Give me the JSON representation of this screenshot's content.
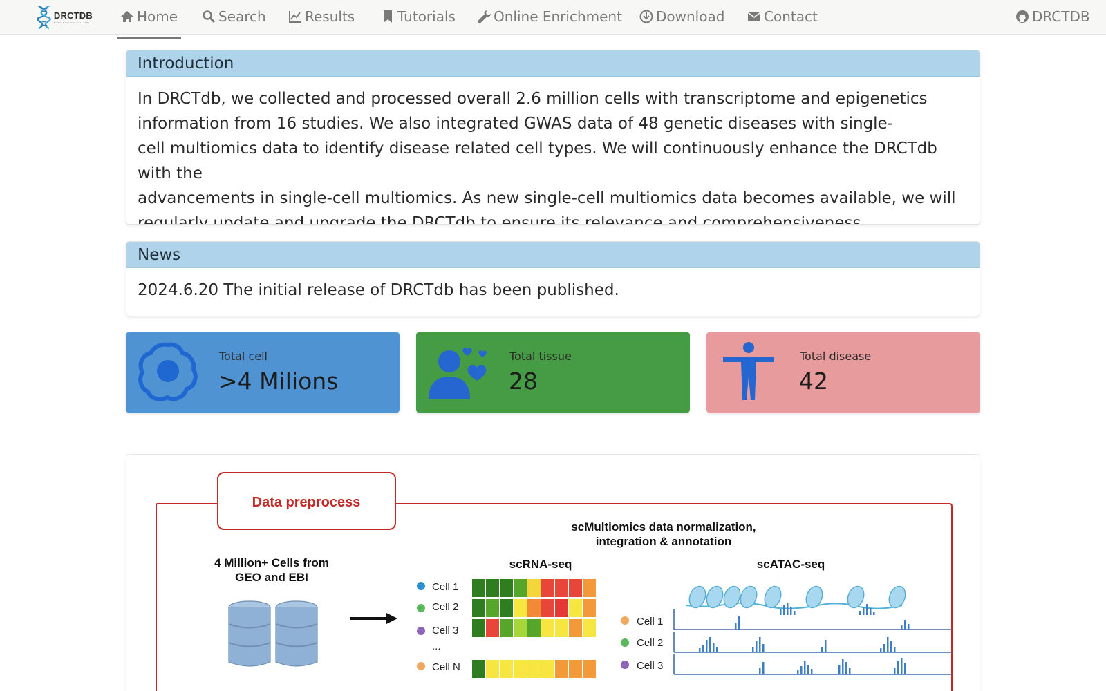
{
  "brand": {
    "name": "DRCTDB",
    "subtitle": "DISEASE RELATED CELL TYPE"
  },
  "nav": {
    "items": [
      {
        "label": "Home",
        "icon": "home-icon"
      },
      {
        "label": "Search",
        "icon": "search-icon"
      },
      {
        "label": "Results",
        "icon": "chart-line-icon"
      },
      {
        "label": "Tutorials",
        "icon": "bookmark-icon"
      },
      {
        "label": "Online Enrichment",
        "icon": "wrench-icon"
      },
      {
        "label": "Download",
        "icon": "download-icon"
      },
      {
        "label": "Contact",
        "icon": "envelope-icon"
      }
    ],
    "github_label": "DRCTDB",
    "github_icon": "github-icon",
    "active": "Home"
  },
  "introduction": {
    "title": "Introduction",
    "lines": [
      "In DRCTdb, we collected and processed overall 2.6 million cells with transcriptome and epigenetics",
      "information from 16 studies. We also integrated GWAS data of 48 genetic diseases with single-",
      "cell multiomics data to identify disease related cell types. We will continuously enhance the DRCTdb with the",
      "advancements in single-cell multiomics. As new single-cell multiomics data becomes available, we will",
      "regularly update and upgrade the DRCTdb to ensure its relevance and comprehensiveness."
    ]
  },
  "news": {
    "title": "News",
    "text": "2024.6.20 The initial release of DRCTdb has been published."
  },
  "stats": [
    {
      "label": "Total cell",
      "value": ">4 Milions",
      "color": "#5093d3",
      "icon": "cell-icon"
    },
    {
      "label": "Total tissue",
      "value": "28",
      "color": "#469c45",
      "icon": "people-hearts-icon"
    },
    {
      "label": "Total disease",
      "value": "42",
      "color": "#e89b9d",
      "icon": "human-body-icon"
    }
  ],
  "figure": {
    "section_label": "Data preprocess",
    "norm_title_line1": "scMultiomics data normalization,",
    "norm_title_line2": "integration & annotation",
    "source_line1": "4 Million+ Cells from",
    "source_line2": "GEO and EBI",
    "rna_title": "scRNA-seq",
    "atac_title": "scATAC-seq",
    "rna_cells": [
      "Cell 1",
      "Cell 2",
      "Cell 3",
      "Cell N"
    ],
    "ellipsis": "...",
    "atac_cells": [
      "Cell 1",
      "Cell 2",
      "Cell 3"
    ],
    "accent_color": "#c62828"
  }
}
